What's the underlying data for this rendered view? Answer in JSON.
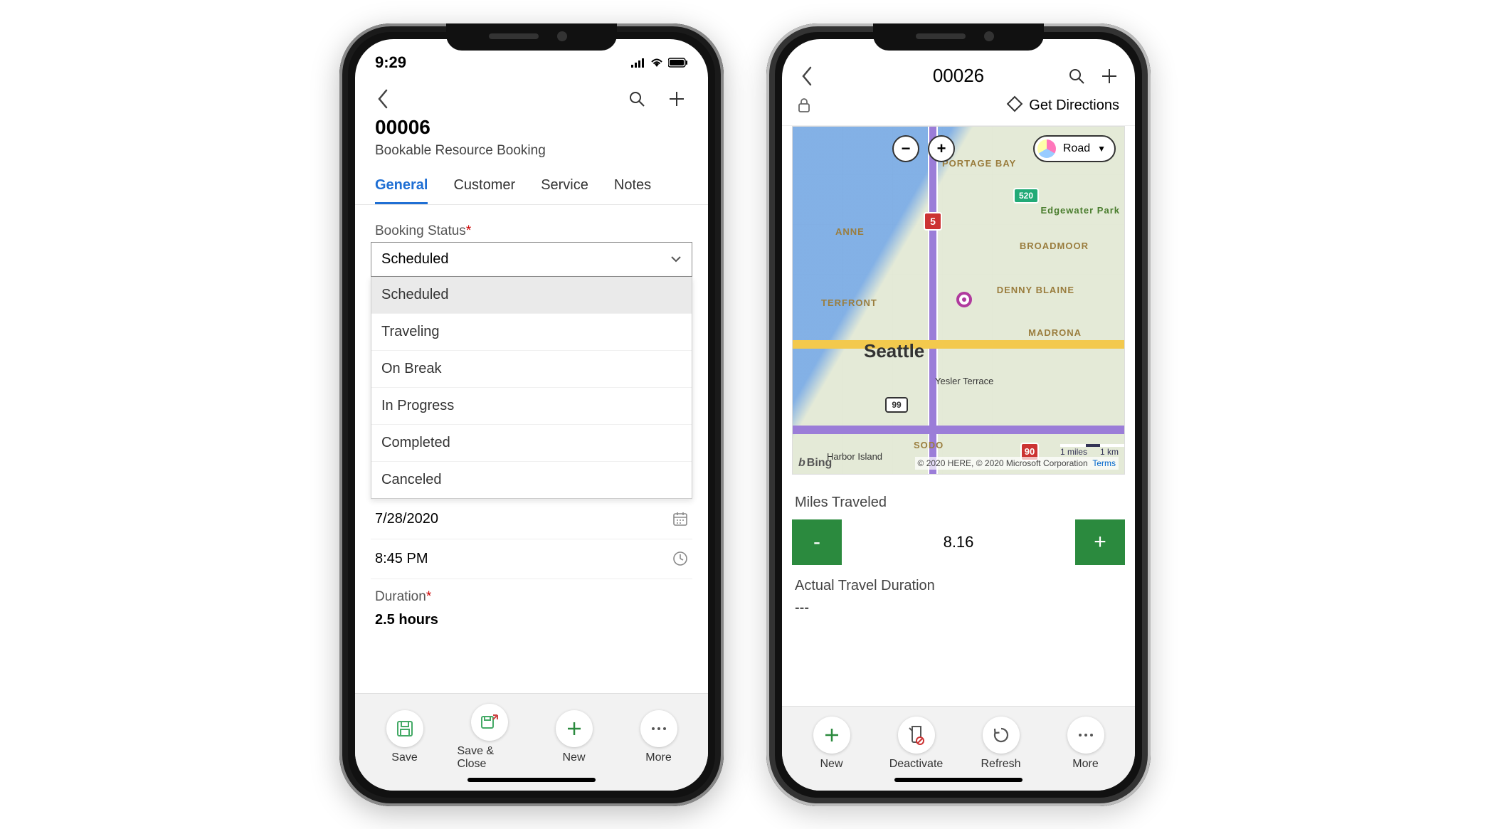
{
  "phone1": {
    "status": {
      "time": "9:29"
    },
    "header": {
      "record_id": "00006",
      "record_sub": "Bookable Resource Booking"
    },
    "tabs": [
      "General",
      "Customer",
      "Service",
      "Notes"
    ],
    "active_tab_index": 0,
    "form": {
      "booking_status_label": "Booking Status",
      "booking_status_value": "Scheduled",
      "booking_status_options": [
        "Scheduled",
        "Traveling",
        "On Break",
        "In Progress",
        "Completed",
        "Canceled"
      ],
      "date_value": "7/28/2020",
      "time_value": "8:45 PM",
      "duration_label": "Duration",
      "duration_value": "2.5 hours"
    },
    "toolbar": {
      "save": "Save",
      "save_close": "Save & Close",
      "new": "New",
      "more": "More"
    }
  },
  "phone2": {
    "header": {
      "title": "00026"
    },
    "directions_label": "Get Directions",
    "map": {
      "layer_mode": "Road",
      "city": "Seattle",
      "labels": {
        "portage_bay": "PORTAGE BAY",
        "edgewater": "Edgewater Park",
        "broadmoor": "BROADMOOR",
        "denny_blaine": "DENNY BLAINE",
        "madrona": "MADRONA",
        "yesler": "Yesler Terrace",
        "sodo": "SODO",
        "anne": "ANNE",
        "terfront": "TERFRONT",
        "harbor": "Harbor Island"
      },
      "shields": {
        "i5": "5",
        "sr520": "520",
        "sr99": "99",
        "i90": "90"
      },
      "scale": {
        "miles": "1 miles",
        "km": "1 km"
      },
      "credits": "© 2020 HERE, © 2020 Microsoft Corporation",
      "terms": "Terms",
      "bing": "Bing"
    },
    "miles": {
      "label": "Miles Traveled",
      "value": "8.16",
      "atd_label": "Actual Travel Duration",
      "atd_value": "---"
    },
    "toolbar": {
      "new": "New",
      "deactivate": "Deactivate",
      "refresh": "Refresh",
      "more": "More"
    }
  }
}
